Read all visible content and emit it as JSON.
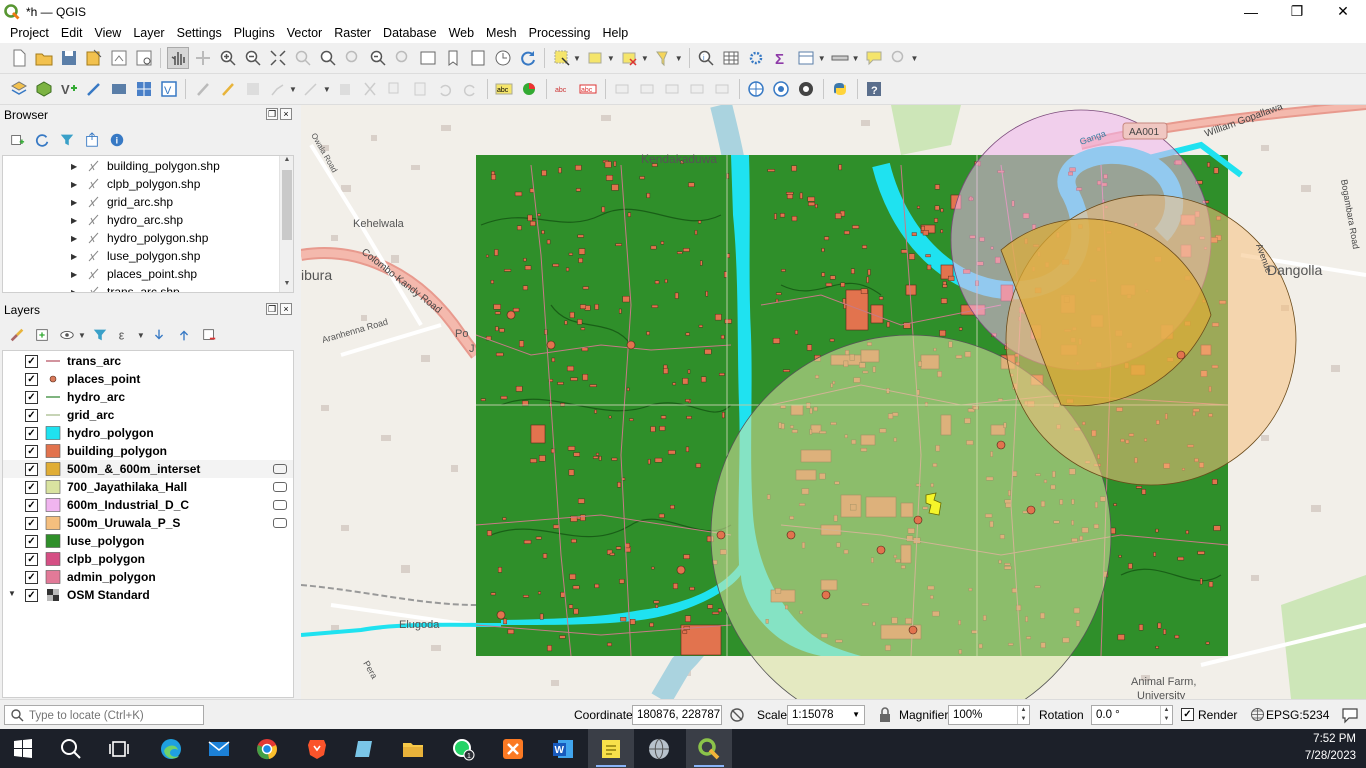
{
  "window": {
    "title": "*h — QGIS",
    "minimize": "—",
    "maximize": "❐",
    "close": "✕"
  },
  "menu": [
    "Project",
    "Edit",
    "View",
    "Layer",
    "Settings",
    "Plugins",
    "Vector",
    "Raster",
    "Database",
    "Web",
    "Mesh",
    "Processing",
    "Help"
  ],
  "browser": {
    "title": "Browser",
    "items": [
      "building_polygon.shp",
      "clpb_polygon.shp",
      "grid_arc.shp",
      "hydro_arc.shp",
      "hydro_polygon.shp",
      "luse_polygon.shp",
      "places_point.shp",
      "trans_arc.shp"
    ]
  },
  "layers": {
    "title": "Layers",
    "items": [
      {
        "name": "trans_arc",
        "symbol": "line",
        "color": "#c77a86",
        "checked": true
      },
      {
        "name": "places_point",
        "symbol": "point",
        "color": "#d87a5a",
        "checked": true
      },
      {
        "name": "hydro_arc",
        "symbol": "line",
        "color": "#5fa15f",
        "checked": true
      },
      {
        "name": "grid_arc",
        "symbol": "line",
        "color": "#b9c9a4",
        "checked": true
      },
      {
        "name": "hydro_polygon",
        "symbol": "fill",
        "color": "#1fe2f0",
        "checked": true
      },
      {
        "name": "building_polygon",
        "symbol": "fill",
        "color": "#e2734e",
        "checked": true
      },
      {
        "name": "500m_&_600m_interset",
        "symbol": "fill",
        "color": "#e0ad35",
        "checked": true,
        "filter": true,
        "selected": true
      },
      {
        "name": "700_Jayathilaka_Hall",
        "symbol": "fill",
        "color": "#d9e3a0",
        "checked": true,
        "filter": true
      },
      {
        "name": "600m_Industrial_D_C",
        "symbol": "fill",
        "color": "#f0b5ef",
        "checked": true,
        "filter": true
      },
      {
        "name": "500m_Uruwala_P_S",
        "symbol": "fill",
        "color": "#f5bf7e",
        "checked": true,
        "filter": true
      },
      {
        "name": "luse_polygon",
        "symbol": "fill",
        "color": "#2f8f2a",
        "checked": true
      },
      {
        "name": "clpb_polygon",
        "symbol": "fill",
        "color": "#d54f84",
        "checked": true
      },
      {
        "name": "admin_polygon",
        "symbol": "fill",
        "color": "#e27a98",
        "checked": true
      },
      {
        "name": "OSM Standard",
        "symbol": "raster",
        "color": "#333333",
        "checked": true,
        "expandable": true
      }
    ]
  },
  "map_labels": {
    "kendakaduwa": "Kendakaduwa",
    "kehelwala": "Kehelwala",
    "colombo_kandy_road": "Colombo-Kandy Road",
    "aa001": "AA001",
    "william_gopallawa": "William Gopallawa",
    "dangolla": "Dangolla",
    "avenue": "Avenue",
    "elugoda": "Elugoda",
    "animal_farm": "Animal Farm,",
    "university": "University",
    "ambura": "ibura",
    "aranhenna_road": "Aranhenna Road",
    "owala_road": "Owala Road",
    "ganga": "Ganga",
    "bogambara": "Bogambara Road",
    "polo": "Po",
    "j": "J",
    "pera": "Pera"
  },
  "status": {
    "locator_placeholder": "Type to locate (Ctrl+K)",
    "coordinate_label": "Coordinate",
    "coordinate_value": "180876, 228787",
    "scale_label": "Scale",
    "scale_value": "1:15078",
    "magnifier_label": "Magnifier",
    "magnifier_value": "100%",
    "rotation_label": "Rotation",
    "rotation_value": "0.0 °",
    "render_label": "Render",
    "crs": "EPSG:5234"
  },
  "taskbar": {
    "time": "7:52 PM",
    "date": "7/28/2023",
    "whatsapp_badge": "1"
  },
  "colors": {
    "landuse": "#2f8f2a",
    "water": "#1fe2f0",
    "building": "#e2734e",
    "buffer_500_uruwala": "#f5bf7e",
    "buffer_600_industrial": "#f0b5ef",
    "buffer_700_jayathilaka": "#d9e3a0",
    "intersect": "#e0ad35"
  }
}
